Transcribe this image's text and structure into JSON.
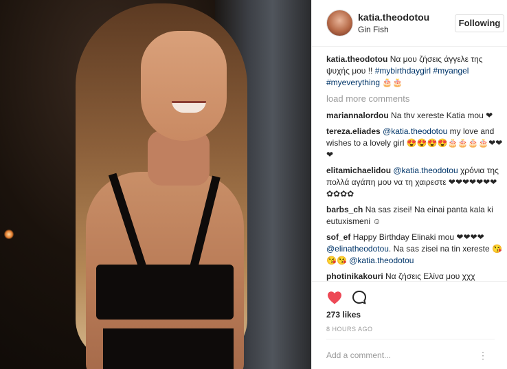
{
  "post": {
    "username": "katia.theodotou",
    "location": "Gin Fish",
    "follow_label": "Following",
    "caption": {
      "user": "katia.theodotou",
      "text": "Να μου ζήσεις άγγελε της ψυχής μου !! ",
      "tags": [
        "#mybirthdaygirl",
        "#myangel",
        "#myeverything"
      ],
      "end": " 🎂🎂"
    },
    "load_more_label": "load more comments",
    "comments": [
      {
        "user": "mariannalordou",
        "segments": [
          {
            "t": "Na thv xereste Katia mou ❤"
          }
        ]
      },
      {
        "user": "tereza.eliades",
        "segments": [
          {
            "t": "@katia.theodotou",
            "tag": true
          },
          {
            "t": " my love and wishes to a lovely girl 😍😍😍😍🎂🎂🎂🎂❤❤❤"
          }
        ]
      },
      {
        "user": "elitamichaelidou",
        "segments": [
          {
            "t": "@katia.theodotou",
            "tag": true
          },
          {
            "t": " χρόνια της πολλά αγάπη μου να τη χαιρεστε ❤❤❤❤❤❤❤✿✿✿✿"
          }
        ]
      },
      {
        "user": "barbs_ch",
        "segments": [
          {
            "t": "Na sas zisei! Na einai panta kala ki eutuxismeni ☺"
          }
        ]
      },
      {
        "user": "sof_ef",
        "segments": [
          {
            "t": "Happy Birthday Elinaki mou ❤❤❤❤ "
          },
          {
            "t": "@elinatheodotou",
            "tag": true
          },
          {
            "t": ". Na sas zisei na tin xereste 😘😘😘 "
          },
          {
            "t": "@katia.theodotou",
            "tag": true
          }
        ]
      },
      {
        "user": "photinikakouri",
        "segments": [
          {
            "t": "Να ζήσεις Ελίνα μου χχχ"
          }
        ]
      }
    ],
    "likes": "273 likes",
    "timestamp": "8 HOURS AGO",
    "add_comment_placeholder": "Add a comment...",
    "more_options": "⋮"
  },
  "colors": {
    "heart": "#ed4956",
    "link": "#003569",
    "muted": "#999999"
  },
  "icons": {
    "like": "heart-icon",
    "comment": "comment-bubble-icon"
  }
}
